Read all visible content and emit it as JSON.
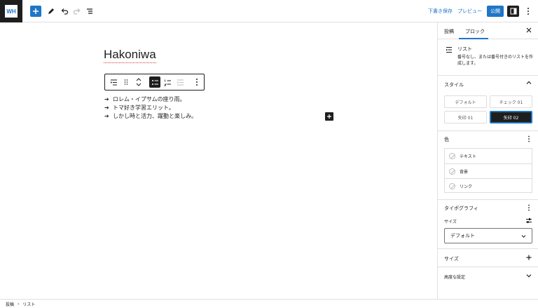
{
  "topbar": {
    "logo_text": "WH",
    "draft_label": "下書き保存",
    "preview_label": "プレビュー",
    "publish_label": "公開"
  },
  "post": {
    "title": "Hakoniwa",
    "list_items": [
      "ロレム・イプサムの座り雨。",
      "トマ好き学習エリット。",
      "しかし時と活力、躍動と楽しみ。"
    ]
  },
  "sidebar": {
    "tabs": {
      "post": "投稿",
      "block": "ブロック"
    },
    "block": {
      "name": "リスト",
      "description": "番号なし、または番号付きのリストを作成します。"
    },
    "styles": {
      "title": "スタイル",
      "options": [
        "デフォルト",
        "チェック 01",
        "矢印 01",
        "矢印 02"
      ],
      "selected": "矢印 02"
    },
    "color": {
      "title": "色",
      "items": [
        "テキスト",
        "背景",
        "リンク"
      ]
    },
    "typography": {
      "title": "タイポグラフィ",
      "size_label": "サイズ",
      "size_value": "デフォルト"
    },
    "size_panel": "サイズ",
    "advanced": "高度な設定"
  },
  "breadcrumb": [
    "投稿",
    "リスト"
  ],
  "colors": {
    "accent": "#1e76c7",
    "dark": "#1e1e1e"
  }
}
